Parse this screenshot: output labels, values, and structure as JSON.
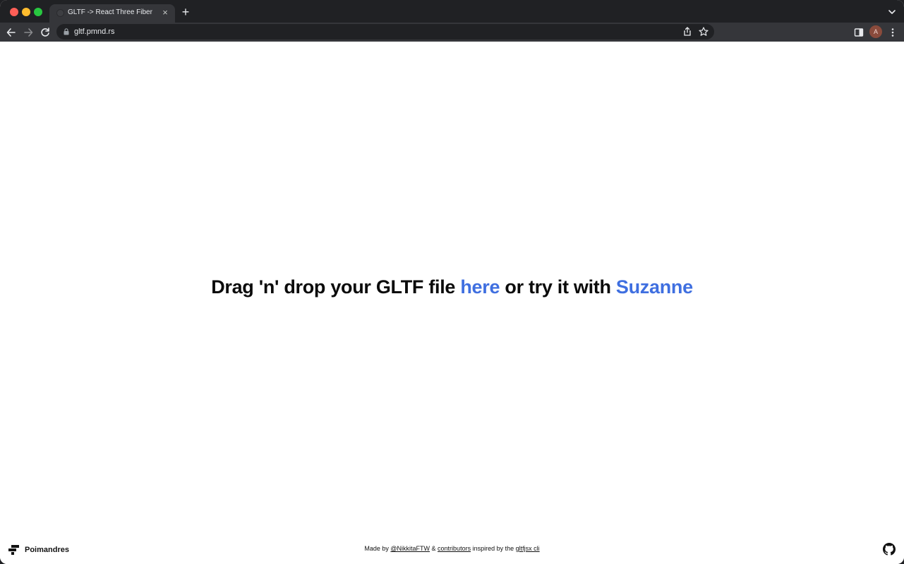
{
  "browser": {
    "tab": {
      "title": "GLTF -> React Three Fiber",
      "close_glyph": "×"
    },
    "new_tab_glyph": "+",
    "address": {
      "url": "gltf.pmnd.rs"
    },
    "profile_initial": "A",
    "icons": [
      "back-icon",
      "forward-icon",
      "reload-icon",
      "lock-icon",
      "share-icon",
      "star-icon",
      "side-panel-icon",
      "menu-icon",
      "tab-search-icon"
    ]
  },
  "page": {
    "headline": {
      "part1": "Drag 'n' drop your GLTF file ",
      "link1": "here",
      "part2": " or try it with ",
      "link2": "Suzanne"
    },
    "footer": {
      "brand": "Poimandres",
      "made_by": "Made by ",
      "author": "@NikkitaFTW",
      "amp": " & ",
      "contributors": "contributors",
      "inspired": " inspired by the ",
      "cli": "gltfjsx cli"
    }
  },
  "colors": {
    "link": "#3f6fe0",
    "chrome_dark": "#202124",
    "chrome_mid": "#35363a"
  }
}
